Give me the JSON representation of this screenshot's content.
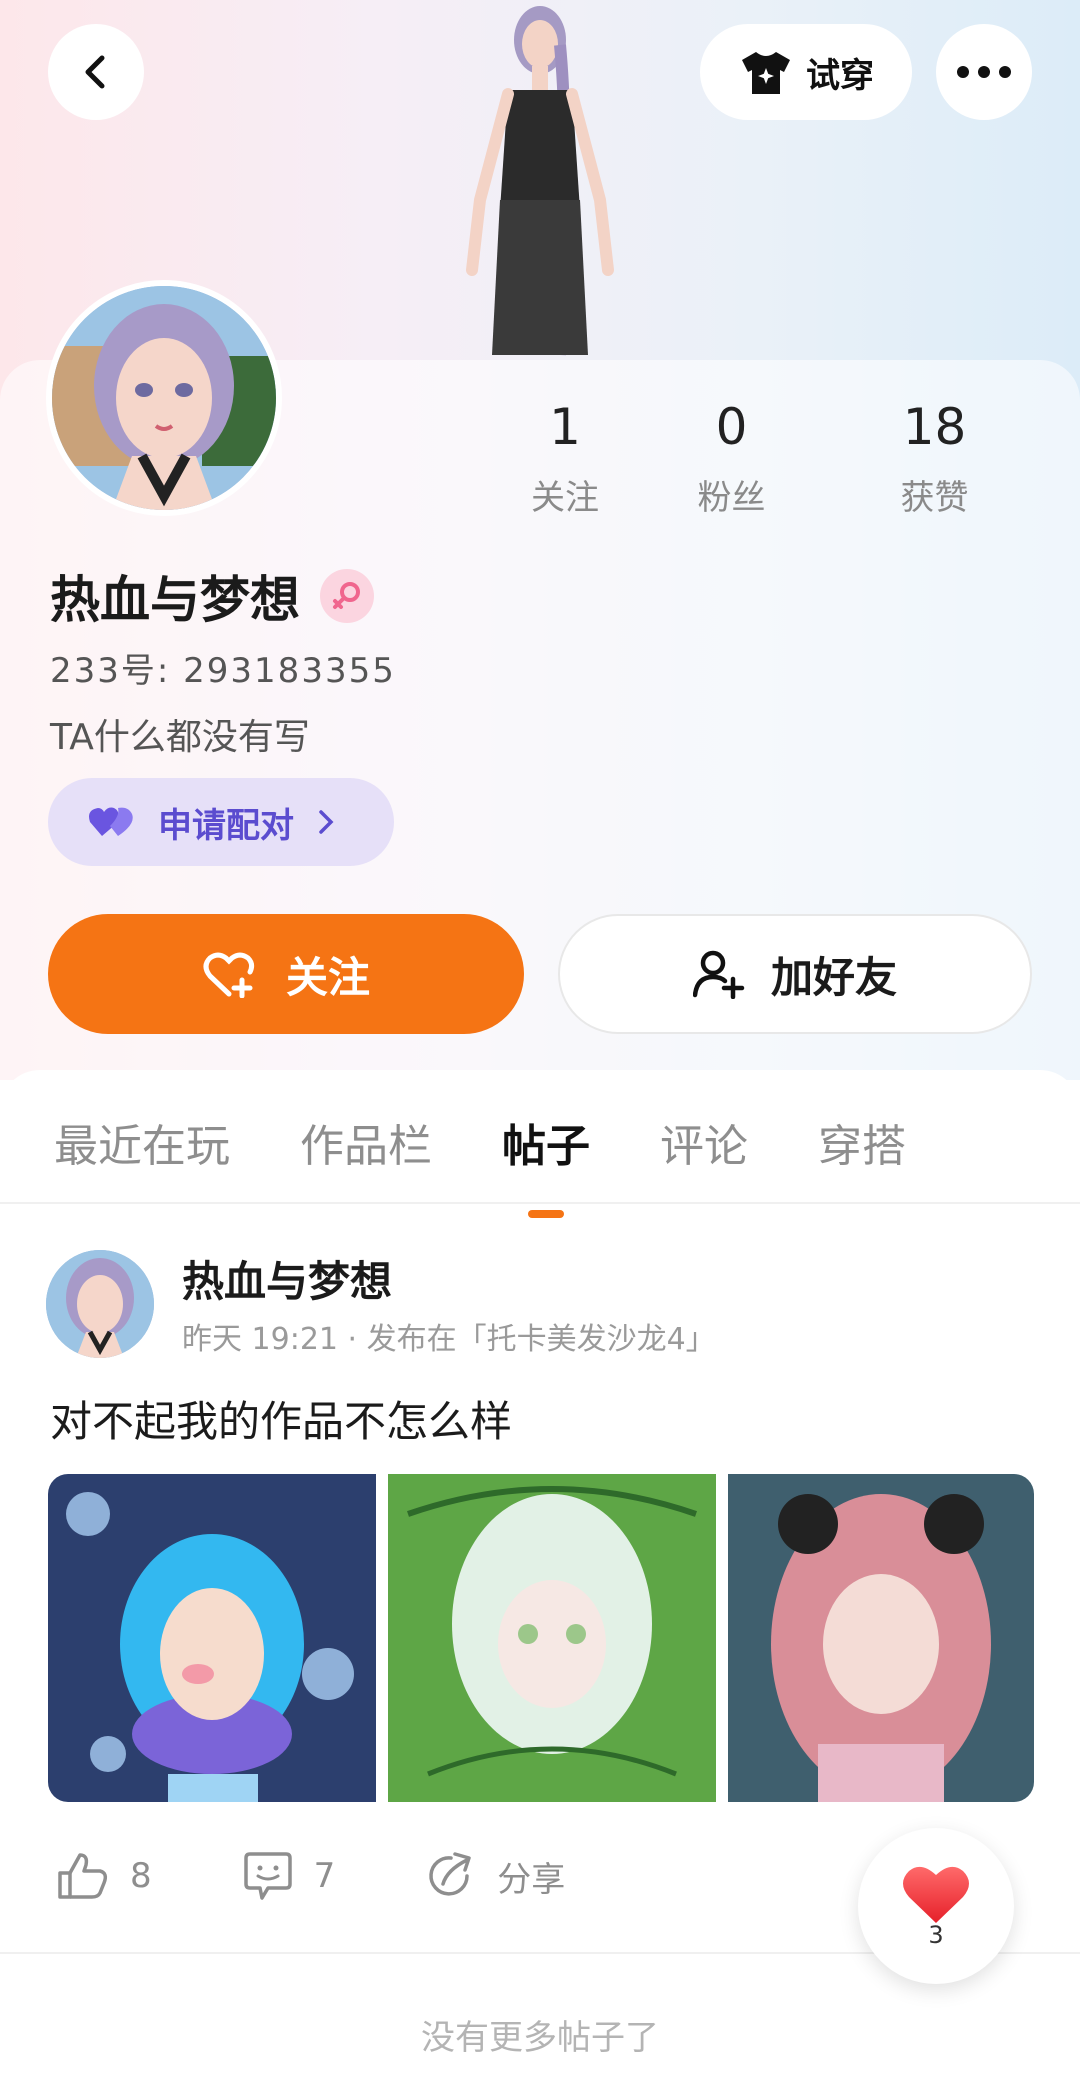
{
  "header": {
    "back_icon": "chevron-left-icon",
    "tryon_label": "试穿",
    "tryon_icon": "shirt-icon",
    "more_icon": "more-dots-icon"
  },
  "profile": {
    "stats": [
      {
        "value": "1",
        "label": "关注"
      },
      {
        "value": "0",
        "label": "粉丝"
      },
      {
        "value": "18",
        "label": "获赞"
      }
    ],
    "name": "热血与梦想",
    "gender": "female",
    "uid": "233号: 293183355",
    "bio": "TA什么都没有写",
    "pair_label": "申请配对",
    "follow_label": "关注",
    "add_friend_label": "加好友"
  },
  "tabs": [
    {
      "label": "最近在玩",
      "active": false
    },
    {
      "label": "作品栏",
      "active": false
    },
    {
      "label": "帖子",
      "active": true
    },
    {
      "label": "评论",
      "active": false
    },
    {
      "label": "穿搭",
      "active": false
    }
  ],
  "post": {
    "author": "热血与梦想",
    "meta": "昨天 19:21 · 发布在「托卡美发沙龙4」",
    "text": "对不起我的作品不怎么样",
    "likes": "8",
    "comments": "7",
    "share_label": "分享"
  },
  "fab": {
    "count": "3"
  },
  "footer": {
    "no_more": "没有更多帖子了"
  },
  "colors": {
    "accent": "#f57414",
    "pair_bg": "#e6e0f8",
    "pair_text": "#5b4ccf"
  }
}
